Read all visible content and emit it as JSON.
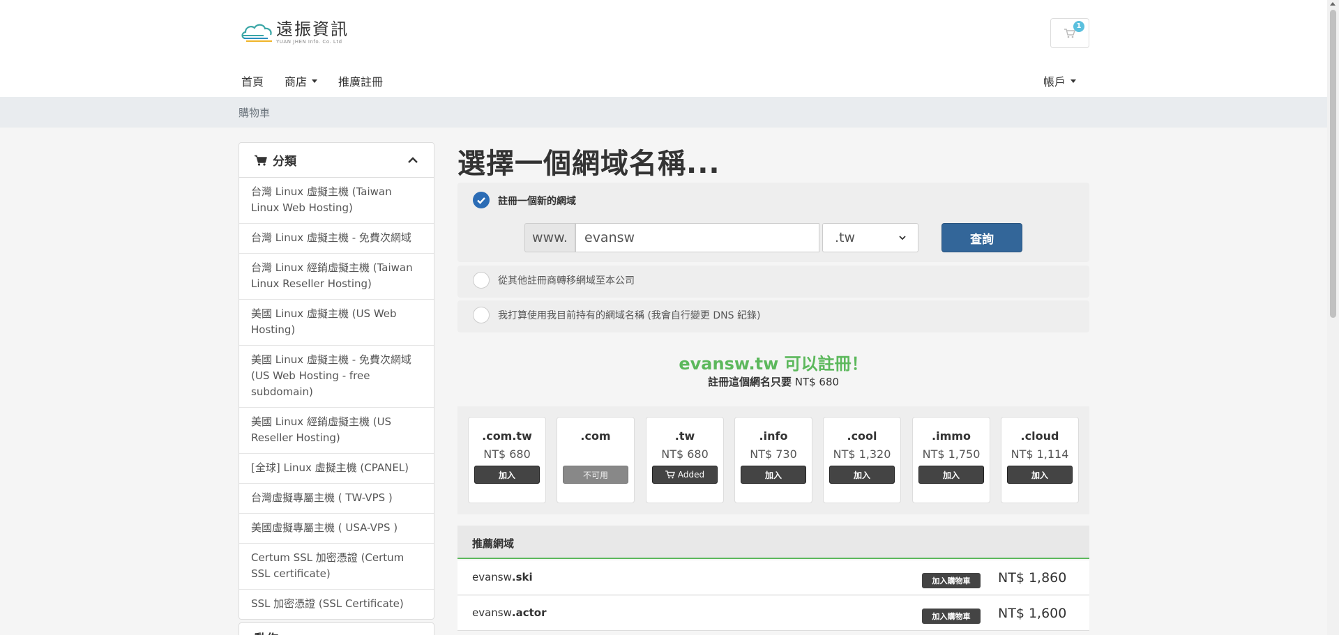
{
  "brand": {
    "name_cn": "遠振資訊",
    "name_en": "YUAN JHEN Info. Co. Ltd"
  },
  "cart": {
    "count": "1"
  },
  "nav": {
    "home": "首頁",
    "shop": "商店",
    "affiliate": "推廣註冊",
    "account": "帳戶"
  },
  "breadcrumb": "購物車",
  "sidebar": {
    "title": "分類",
    "items": [
      "台灣 Linux 虛擬主機 (Taiwan Linux Web Hosting)",
      "台灣 Linux 虛擬主機 - 免費次網域",
      "台灣 Linux 經銷虛擬主機 (Taiwan Linux Reseller Hosting)",
      "美國 Linux 虛擬主機 (US Web Hosting)",
      "美國 Linux 虛擬主機 - 免費次網域 (US Web Hosting - free subdomain)",
      "美國 Linux 經銷虛擬主機 (US Reseller Hosting)",
      "[全球] Linux 虛擬主機 (CPANEL)",
      "台灣虛擬專屬主機 ( TW-VPS )",
      "美國虛擬專屬主機 ( USA-VPS )",
      "Certum SSL 加密憑證 (Certum SSL certificate)",
      "SSL 加密憑證 (SSL Certificate)"
    ],
    "second_title": "動作"
  },
  "main": {
    "title": "選擇一個網域名稱...",
    "options": {
      "register": "註冊一個新的網域",
      "transfer": "從其他註冊商轉移網域至本公司",
      "own": "我打算使用我目前持有的網域名稱 (我會自行變更 DNS 紀錄)"
    },
    "search": {
      "prefix": "www.",
      "value": "evansw",
      "tld": ".tw",
      "button": "查詢"
    },
    "availability": {
      "title": "evansw.tw 可以註冊！",
      "sub_label": "註冊這個網名只要",
      "sub_price": "NT$ 680"
    },
    "tlds": [
      {
        "name": ".com.tw",
        "price": "NT$ 680",
        "button": "加入",
        "state": "add"
      },
      {
        "name": ".com",
        "price": "",
        "button": "不可用",
        "state": "disabled"
      },
      {
        "name": ".tw",
        "price": "NT$ 680",
        "button": "Added",
        "state": "added"
      },
      {
        "name": ".info",
        "price": "NT$ 730",
        "button": "加入",
        "state": "add"
      },
      {
        "name": ".cool",
        "price": "NT$ 1,320",
        "button": "加入",
        "state": "add"
      },
      {
        "name": ".immo",
        "price": "NT$ 1,750",
        "button": "加入",
        "state": "add"
      },
      {
        "name": ".cloud",
        "price": "NT$ 1,114",
        "button": "加入",
        "state": "add"
      }
    ],
    "suggestions": {
      "title": "推薦網域",
      "rows": [
        {
          "sld": "evansw",
          "tld": ".ski",
          "button": "加入購物車",
          "price": "NT$ 1,860"
        },
        {
          "sld": "evansw",
          "tld": ".actor",
          "button": "加入購物車",
          "price": "NT$ 1,600"
        }
      ]
    }
  },
  "colors": {
    "primary": "#336699",
    "success": "#5cb85c",
    "badge": "#5bc0de"
  }
}
